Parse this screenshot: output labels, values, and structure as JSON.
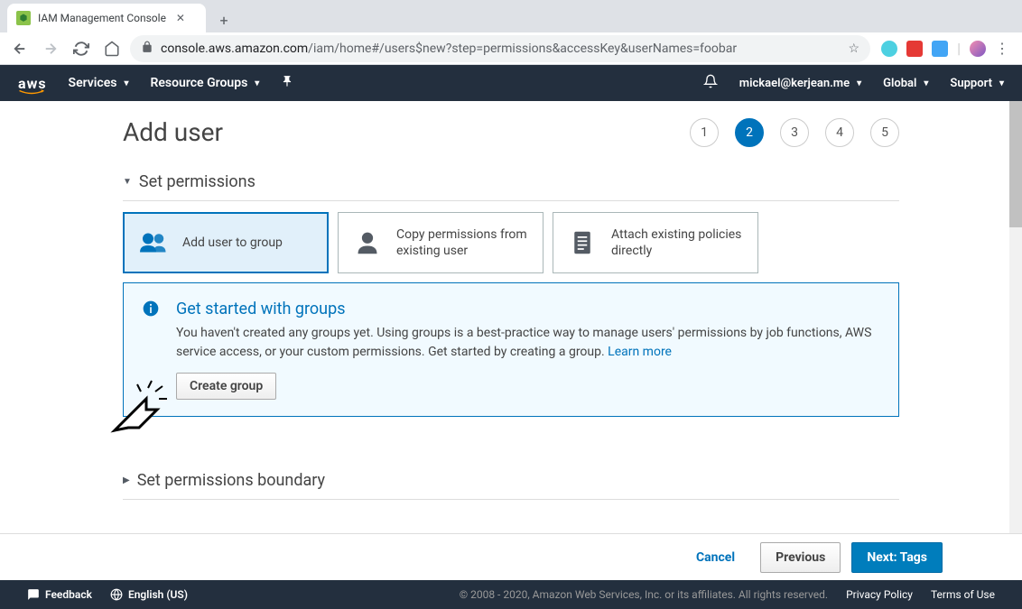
{
  "browser": {
    "tab_title": "IAM Management Console",
    "url_host": "console.aws.amazon.com",
    "url_path": "/iam/home#/users$new?step=permissions&accessKey&userNames=foobar"
  },
  "aws_nav": {
    "services": "Services",
    "resource_groups": "Resource Groups",
    "user_email": "mickael@kerjean.me",
    "region": "Global",
    "support": "Support"
  },
  "page": {
    "title": "Add user",
    "steps": [
      "1",
      "2",
      "3",
      "4",
      "5"
    ],
    "active_step": 2
  },
  "section_permissions": {
    "title": "Set permissions",
    "options": [
      {
        "label": "Add user to group",
        "selected": true
      },
      {
        "label": "Copy permissions from existing user",
        "selected": false
      },
      {
        "label": "Attach existing policies directly",
        "selected": false
      }
    ]
  },
  "info_box": {
    "heading": "Get started with groups",
    "body": "You haven't created any groups yet. Using groups is a best-practice way to manage users' permissions by job functions, AWS service access, or your custom permissions. Get started by creating a group. ",
    "learn_more": "Learn more",
    "create_group": "Create group"
  },
  "section_boundary": {
    "title": "Set permissions boundary"
  },
  "actions": {
    "cancel": "Cancel",
    "previous": "Previous",
    "next": "Next: Tags"
  },
  "footer": {
    "feedback": "Feedback",
    "language": "English (US)",
    "copyright": "© 2008 - 2020, Amazon Web Services, Inc. or its affiliates. All rights reserved.",
    "privacy": "Privacy Policy",
    "terms": "Terms of Use"
  }
}
